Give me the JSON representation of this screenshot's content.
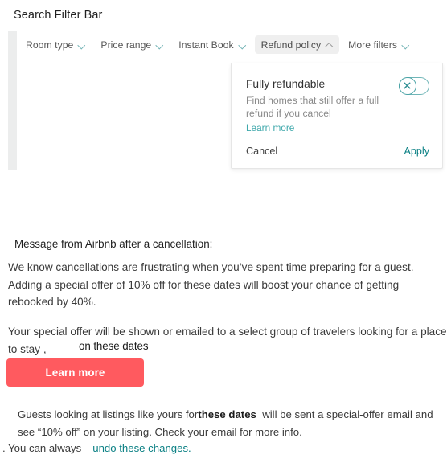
{
  "page_title": "Search Filter Bar",
  "filter_bar": {
    "chips": [
      {
        "label": "Room type",
        "chevron": "chevron-down-icon",
        "active": false
      },
      {
        "label": "Price range",
        "chevron": "chevron-down-icon",
        "active": false
      },
      {
        "label": "Instant Book",
        "chevron": "chevron-down-icon",
        "active": false
      },
      {
        "label": "Refund policy",
        "chevron": "chevron-up-icon",
        "active": true
      },
      {
        "label": "More filters",
        "chevron": "chevron-down-icon",
        "active": false
      }
    ]
  },
  "popover": {
    "title": "Fully refundable",
    "description": "Find homes that still offer a full refund if you cancel",
    "learn_more_label": "Learn more",
    "toggle": {
      "state": "off",
      "icon": "close-x-icon"
    },
    "cancel_label": "Cancel",
    "apply_label": "Apply"
  },
  "message": {
    "label": "Message from Airbnb after a cancellation:",
    "paragraph1": "We know cancellations are frustrating when you’ve spent time preparing for a guest. Adding a special offer of 10% off for these dates will boost your chance of getting rebooked by 40%.",
    "paragraph2": "Your special offer will be shown or emailed to a select group of travelers looking for a place to stay ,",
    "overlay_dates": "on these dates",
    "cta_label": "Learn more"
  },
  "footer": {
    "line1_before": "Guests looking at listings like yours for",
    "line1_bold": "these dates",
    "line1_after": "will be sent a special-offer email and  see “10% off” on your listing. Check your  email for more info.",
    "line2_prefix": ". You can always",
    "line2_link": "undo these changes."
  },
  "colors": {
    "coral": "#FF5A5F",
    "teal": "#0B8084",
    "teal_light": "#3FA8AB",
    "chip_active_bg": "#EFEFEF",
    "gutter_gray": "#ECEDED"
  }
}
